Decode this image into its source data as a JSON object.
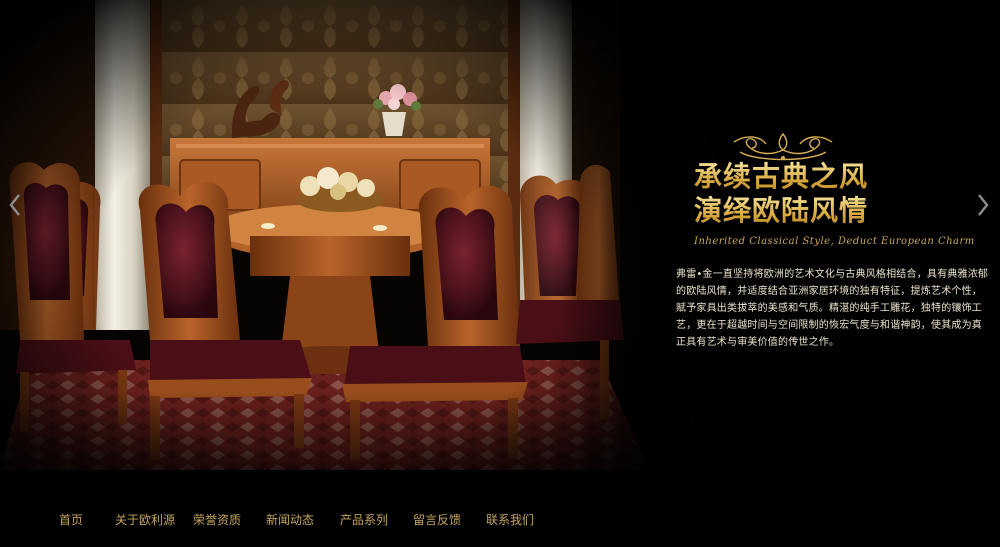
{
  "slider": {
    "prev_icon": "chevron-left-icon",
    "next_icon": "chevron-right-icon"
  },
  "slogan": {
    "line1": "承续古典之风",
    "line2": "演绎欧陆风情",
    "english": "Inherited Classical Style, Deduct European Charm"
  },
  "description": "弗雷•金一直坚持将欧洲的艺术文化与古典风格相结合，具有典雅浓郁的欧陆风情，并适度结合亚洲家居环境的独有特征，提炼艺术个性，赋予家具出类拔萃的美感和气质。精湛的纯手工雕花，独特的镶饰工艺，更在于超越时间与空间限制的恢宏气度与和谐神韵，使其成为真正具有艺术与审美价值的传世之作。",
  "nav": {
    "items": [
      {
        "label": "首页"
      },
      {
        "label": "关于欧利源"
      },
      {
        "label": "荣誉资质"
      },
      {
        "label": "新闻动态"
      },
      {
        "label": "产品系列"
      },
      {
        "label": "留言反馈"
      },
      {
        "label": "联系我们"
      }
    ]
  },
  "colors": {
    "gold": "#c5a45d",
    "slogan_gold": "#e7c66b",
    "text_light": "#ece3cc",
    "background": "#000000"
  }
}
